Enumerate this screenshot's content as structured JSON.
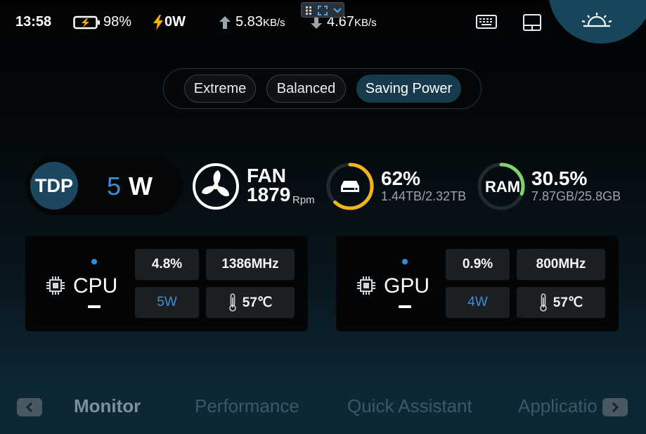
{
  "status_bar": {
    "time": "13:58",
    "battery_percent": "98%",
    "power": "0W",
    "upload_value": "5.83",
    "upload_unit": "KB/s",
    "download_value": "4.67",
    "download_unit": "KB/s",
    "icons": [
      "battery-charging-icon",
      "lightning-icon",
      "upload-arrow-icon",
      "download-arrow-icon",
      "keyboard-icon",
      "touchpad-icon",
      "brightness-icon",
      "drag-handle-icon",
      "screenshot-region-icon",
      "chevron-down-icon"
    ]
  },
  "modes": {
    "items": [
      "Extreme",
      "Balanced",
      "Saving Power"
    ],
    "selected": "Saving Power"
  },
  "tdp": {
    "label": "TDP",
    "value": "5",
    "unit": "W"
  },
  "fan": {
    "label": "FAN",
    "rpm": "1879",
    "unit": "Rpm"
  },
  "storage": {
    "percent": "62%",
    "used_total": "1.44TB/2.32TB",
    "ring_fraction": 0.62,
    "ring_color": "#f2b51c"
  },
  "ram": {
    "label": "RAM",
    "percent": "30.5%",
    "used_total": "7.87GB/25.8GB",
    "ring_fraction": 0.305,
    "ring_color": "#7ed36a"
  },
  "cpu": {
    "label": "CPU",
    "usage": "4.8%",
    "clock": "1386MHz",
    "power": "5W",
    "temp": "57℃"
  },
  "gpu": {
    "label": "GPU",
    "usage": "0.9%",
    "clock": "800MHz",
    "power": "4W",
    "temp": "57℃"
  },
  "nav": {
    "tabs": [
      "Monitor",
      "Performance",
      "Quick Assistant",
      "Applicatio"
    ],
    "active": "Monitor"
  },
  "colors": {
    "accent_blue": "#3a8fd6",
    "active_mode": "#173b4d",
    "lightning": "#f5b300"
  }
}
